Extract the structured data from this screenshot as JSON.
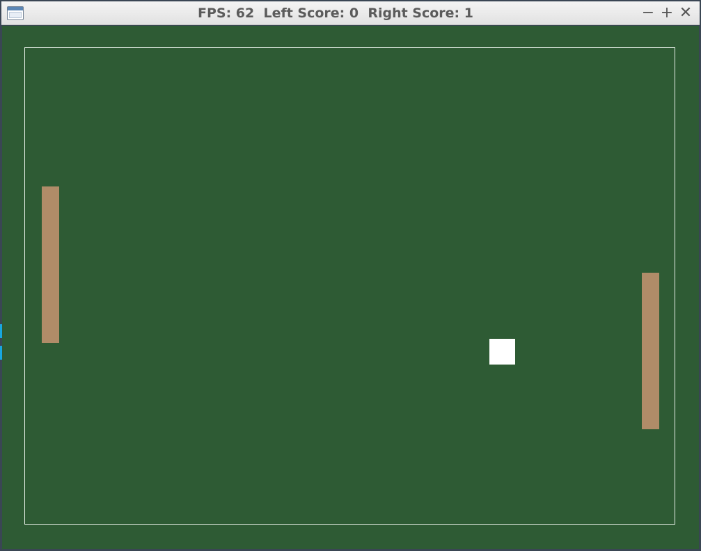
{
  "window": {
    "title": "FPS: 62  Left Score: 0  Right Score: 1",
    "icon": "window-app-icon",
    "controls": {
      "minimize": "−",
      "maximize": "+",
      "close": "✕"
    }
  },
  "game": {
    "fps": 62,
    "left_score": 0,
    "right_score": 1,
    "colors": {
      "background": "#2e5b34",
      "court_border": "#e8f0e8",
      "paddle": "#b08c68",
      "ball": "#ffffff"
    }
  }
}
